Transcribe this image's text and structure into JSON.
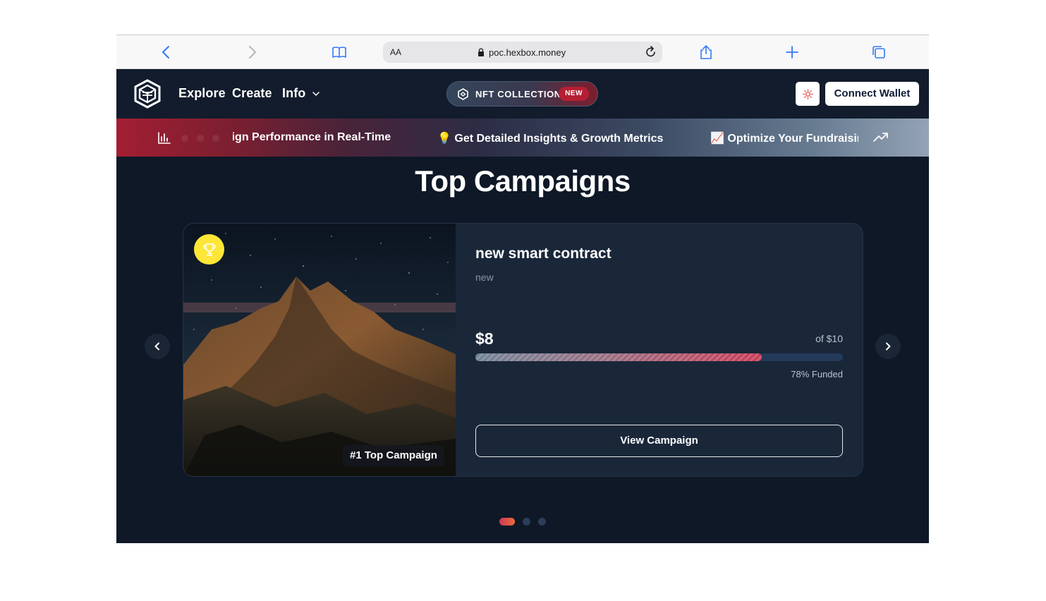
{
  "browser": {
    "url": "poc.hexbox.money",
    "text_size_label": "AA"
  },
  "nav": {
    "items": [
      "Explore",
      "Create",
      "Info"
    ],
    "nft_label": "NFT COLLECTION",
    "nft_badge": "NEW",
    "connect_label": "Connect Wallet"
  },
  "ticker": {
    "items": [
      "Track Campaign Performance in Real-Time",
      "💡 Get Detailed Insights & Growth Metrics",
      "📈 Optimize Your Fundraising"
    ]
  },
  "section_title": "Top Campaigns",
  "campaign": {
    "title": "new smart contract",
    "subtitle": "new",
    "raised": "$8",
    "goal": "of $10",
    "funded_fraction": 0.78,
    "funded_label": "78% Funded",
    "rank_label": "#1 Top Campaign",
    "button_label": "View Campaign"
  },
  "carousel": {
    "slide_count": 3,
    "active_index": 0
  },
  "colors": {
    "page_bg": "#0e1827",
    "accent_red": "#c93a55",
    "trophy_yellow": "#fde637"
  }
}
